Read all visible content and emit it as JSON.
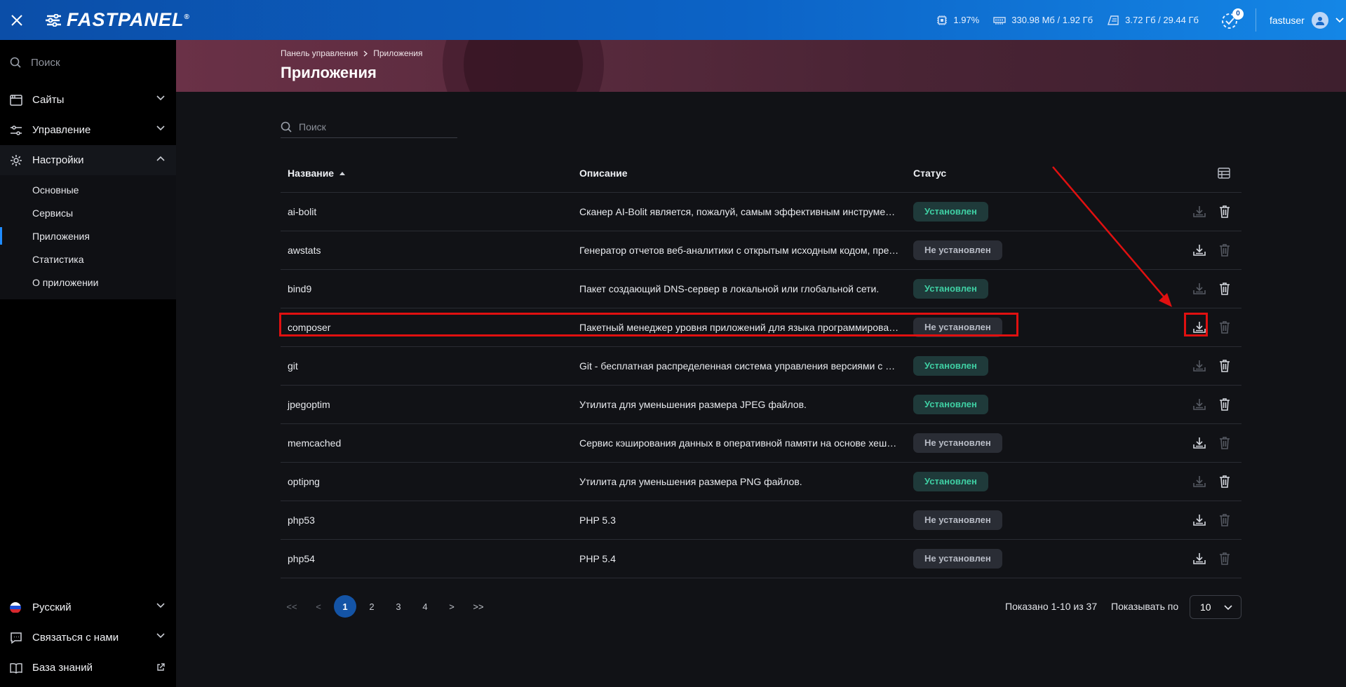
{
  "app": {
    "logo": "FASTPANEL",
    "logo_reg": "®"
  },
  "stats": {
    "cpu": "1.97%",
    "ram": "330.98 Мб / 1.92 Гб",
    "disk": "3.72 Гб / 29.44 Гб"
  },
  "notifications": {
    "count": "0"
  },
  "user": {
    "name": "fastuser"
  },
  "sidebar": {
    "search_placeholder": "Поиск",
    "items": [
      {
        "label": "Сайты"
      },
      {
        "label": "Управление"
      },
      {
        "label": "Настройки"
      }
    ],
    "settings_sub": [
      {
        "label": "Основные"
      },
      {
        "label": "Сервисы"
      },
      {
        "label": "Приложения"
      },
      {
        "label": "Статистика"
      },
      {
        "label": "О приложении"
      }
    ],
    "bottom": [
      {
        "label": "Русский"
      },
      {
        "label": "Связаться с нами"
      },
      {
        "label": "База знаний"
      }
    ]
  },
  "breadcrumb": {
    "home": "Панель управления",
    "current": "Приложения"
  },
  "page": {
    "title": "Приложения",
    "search_placeholder": "Поиск"
  },
  "table": {
    "headers": {
      "name": "Название",
      "desc": "Описание",
      "status": "Статус"
    },
    "rows": [
      {
        "name": "ai-bolit",
        "desc": "Сканер AI-Bolit является, пожалуй, самым эффективным инструментом для поиска вредоносного кода",
        "status": "Установлен",
        "installed": true
      },
      {
        "name": "awstats",
        "desc": "Генератор отчетов веб-аналитики с открытым исходным кодом, предназначенный для анализа",
        "status": "Не установлен",
        "installed": false
      },
      {
        "name": "bind9",
        "desc": "Пакет создающий DNS-сервер в локальной или глобальной сети.",
        "status": "Установлен",
        "installed": true
      },
      {
        "name": "composer",
        "desc": "Пакетный менеджер уровня приложений для языка программирования PHP",
        "status": "Не установлен",
        "installed": false
      },
      {
        "name": "git",
        "desc": "Git - бесплатная распределенная система управления версиями с открытым исходным кодом",
        "status": "Установлен",
        "installed": true
      },
      {
        "name": "jpegoptim",
        "desc": "Утилита для уменьшения размера JPEG файлов.",
        "status": "Установлен",
        "installed": true
      },
      {
        "name": "memcached",
        "desc": "Сервис кэширования данных в оперативной памяти на основе хеш-таблицы",
        "status": "Не установлен",
        "installed": false
      },
      {
        "name": "optipng",
        "desc": "Утилита для уменьшения размера PNG файлов.",
        "status": "Установлен",
        "installed": true
      },
      {
        "name": "php53",
        "desc": "PHP 5.3",
        "status": "Не установлен",
        "installed": false
      },
      {
        "name": "php54",
        "desc": "PHP 5.4",
        "status": "Не установлен",
        "installed": false
      }
    ]
  },
  "pagination": {
    "first": "<<",
    "prev": "<",
    "pages": [
      "1",
      "2",
      "3",
      "4"
    ],
    "next": ">",
    "last": ">>",
    "current": "1",
    "shown": "Показано 1-10 из 37",
    "per_page_label": "Показывать по",
    "per_page": "10"
  },
  "colors": {
    "accent": "#1f8cff",
    "installed": "#3fd0a4",
    "highlight": "#e01010"
  }
}
